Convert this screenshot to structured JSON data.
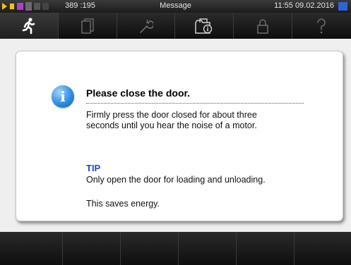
{
  "status_bar": {
    "counter": "389 :195",
    "title": "Message",
    "time": "11:55",
    "date": "09.02.2016",
    "icons": [
      "play-icon",
      "door-icon",
      "program-icon",
      "waveform-icon",
      "printer-icon",
      "lock-icon"
    ],
    "flag_color": "#2f64d6"
  },
  "tabs": [
    {
      "icon": "running-person-icon",
      "active": true
    },
    {
      "icon": "documents-icon",
      "active": false
    },
    {
      "icon": "wrench-icon",
      "active": false
    },
    {
      "icon": "folder-info-icon",
      "active": false
    },
    {
      "icon": "locked-icon",
      "active": false
    },
    {
      "icon": "help-icon",
      "active": false
    }
  ],
  "dialog": {
    "icon": "info-icon",
    "title": "Please close the door.",
    "body": "Firmly press the door closed for about three\nseconds until you hear the noise of a motor.",
    "tip_label": "TIP",
    "tip_text": "Only open the door for loading and unloading.",
    "tip_extra": "This saves energy.",
    "accent_color": "#2146c8"
  },
  "bottom_bar": {
    "buttons": [
      "",
      "",
      "",
      "",
      "",
      ""
    ]
  }
}
